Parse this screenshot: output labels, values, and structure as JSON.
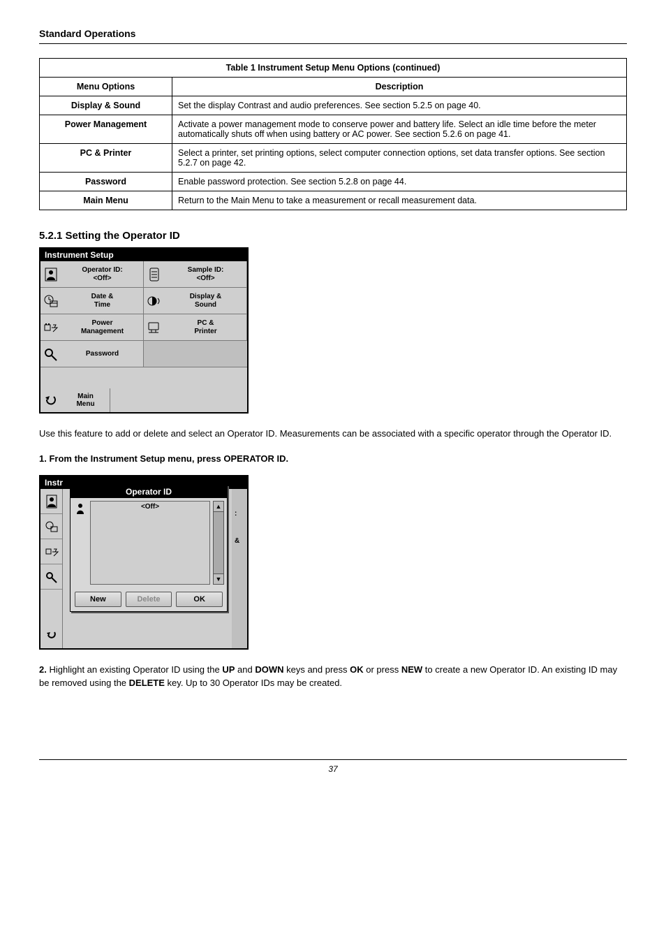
{
  "running_head": "Standard Operations",
  "table": {
    "caption_prefix": "Table 1 Instrument Setup Menu Options (continued)",
    "headers": [
      "Menu Options",
      "Description"
    ],
    "rows": [
      {
        "option": "Display & Sound",
        "desc": "Set the display Contrast and audio preferences. See section 5.2.5 on page 40."
      },
      {
        "option": "Power Management",
        "desc": "Activate a power management mode to conserve power and battery life. Select an idle time before the meter automatically shuts off when using battery or AC power. See section 5.2.6 on page 41."
      },
      {
        "option": "PC & Printer",
        "desc": "Select a printer, set printing options, select computer connection options, set data transfer options. See section 5.2.7 on page 42."
      },
      {
        "option": "Password",
        "desc": "Enable password protection. See section 5.2.8 on page 44."
      },
      {
        "option": "Main Menu",
        "desc": "Return to the Main Menu to take a measurement or recall measurement data."
      }
    ]
  },
  "section1": {
    "number": "5.2.1",
    "title": "Setting the Operator ID",
    "para": "Use this feature to add or delete and select an Operator ID. Measurements can be associated with a specific operator through the Operator ID."
  },
  "fig1": {
    "title": "Instrument Setup",
    "operator_id_l1": "Operator ID:",
    "operator_id_l2": "<Off>",
    "sample_id_l1": "Sample ID:",
    "sample_id_l2": "<Off>",
    "date_l1": "Date &",
    "date_l2": "Time",
    "display_l1": "Display &",
    "display_l2": "Sound",
    "power_l1": "Power",
    "power_l2": "Management",
    "pc_l1": "PC &",
    "pc_l2": "Printer",
    "password": "Password",
    "main_l1": "Main",
    "main_l2": "Menu"
  },
  "steps": {
    "step1": "1. From the Instrument Setup menu, press OPERATOR ID."
  },
  "fig2": {
    "title_bg": "Instrument Setup",
    "popup_title": "Operator ID",
    "list_item": "<Off>",
    "right_tag1": ":",
    "right_tag2": "&",
    "btn_new": "New",
    "btn_delete": "Delete",
    "btn_ok": "OK"
  },
  "para2": "2. Highlight an existing Operator ID using the UP and DOWN keys and press OK or press NEW to create a new Operator ID. An existing ID may be removed using the DELETE key. Up to 30 Operator IDs may be created.",
  "footer": "37"
}
